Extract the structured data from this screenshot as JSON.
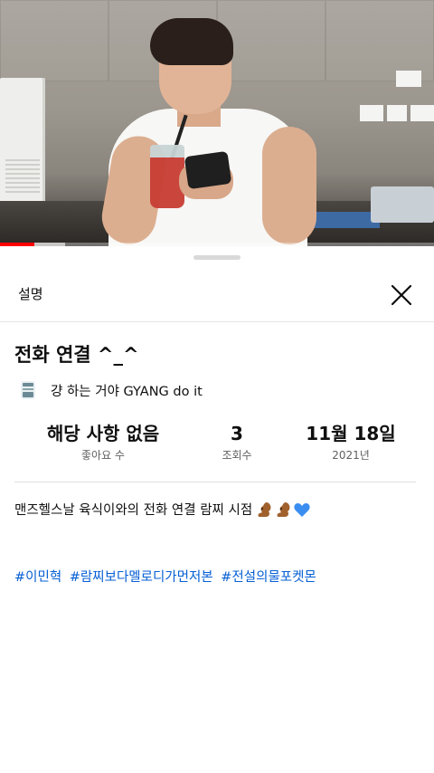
{
  "video": {
    "progress_fraction": 0.08,
    "buffered_fraction": 0.15,
    "accent_color": "#ff0000"
  },
  "sheet": {
    "title": "설명",
    "close_icon": "close-icon"
  },
  "details": {
    "video_title": "전화 연결 ^_^",
    "channel_icon": "channel-avatar-icon",
    "channel_name": "걍 하는 거야 GYANG do it",
    "stats": {
      "likes_value": "해당 사항 없음",
      "likes_label": "좋아요 수",
      "views_value": "3",
      "views_label": "조회수",
      "date_value": "11월 18일",
      "date_label": "2021년"
    },
    "description": "맨즈헬스날 육식이와의 전화 연결 람찌 시점",
    "description_emojis": [
      "squirrel-icon",
      "squirrel-icon",
      "blue-heart-icon"
    ],
    "hashtags": [
      "#이민혁",
      "#람찌보다멜로디가먼저본",
      "#전설의물포켓몬"
    ],
    "link_color": "#065fd4"
  }
}
